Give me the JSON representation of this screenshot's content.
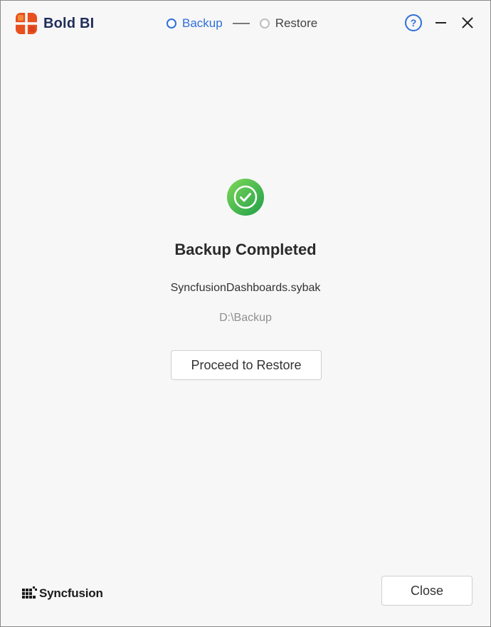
{
  "app": {
    "name": "Bold BI",
    "logo_icon": "bold-bi-logo-icon",
    "brand_color": "#e8501f"
  },
  "steps": [
    {
      "label": "Backup",
      "state": "active"
    },
    {
      "label": "Restore",
      "state": "pending"
    }
  ],
  "window_controls": {
    "help_icon": "?",
    "minimize_icon": "minimize-icon",
    "close_icon": "close-icon"
  },
  "main": {
    "status_icon": "check-circle-icon",
    "status_color": "#3cb043",
    "title": "Backup Completed",
    "filename": "SyncfusionDashboards.sybak",
    "path": "D:\\Backup",
    "proceed_label": "Proceed to Restore"
  },
  "footer": {
    "vendor": "Syncfusion",
    "close_label": "Close"
  },
  "colors": {
    "accent": "#2f6fd8",
    "background": "#f7f7f7"
  }
}
